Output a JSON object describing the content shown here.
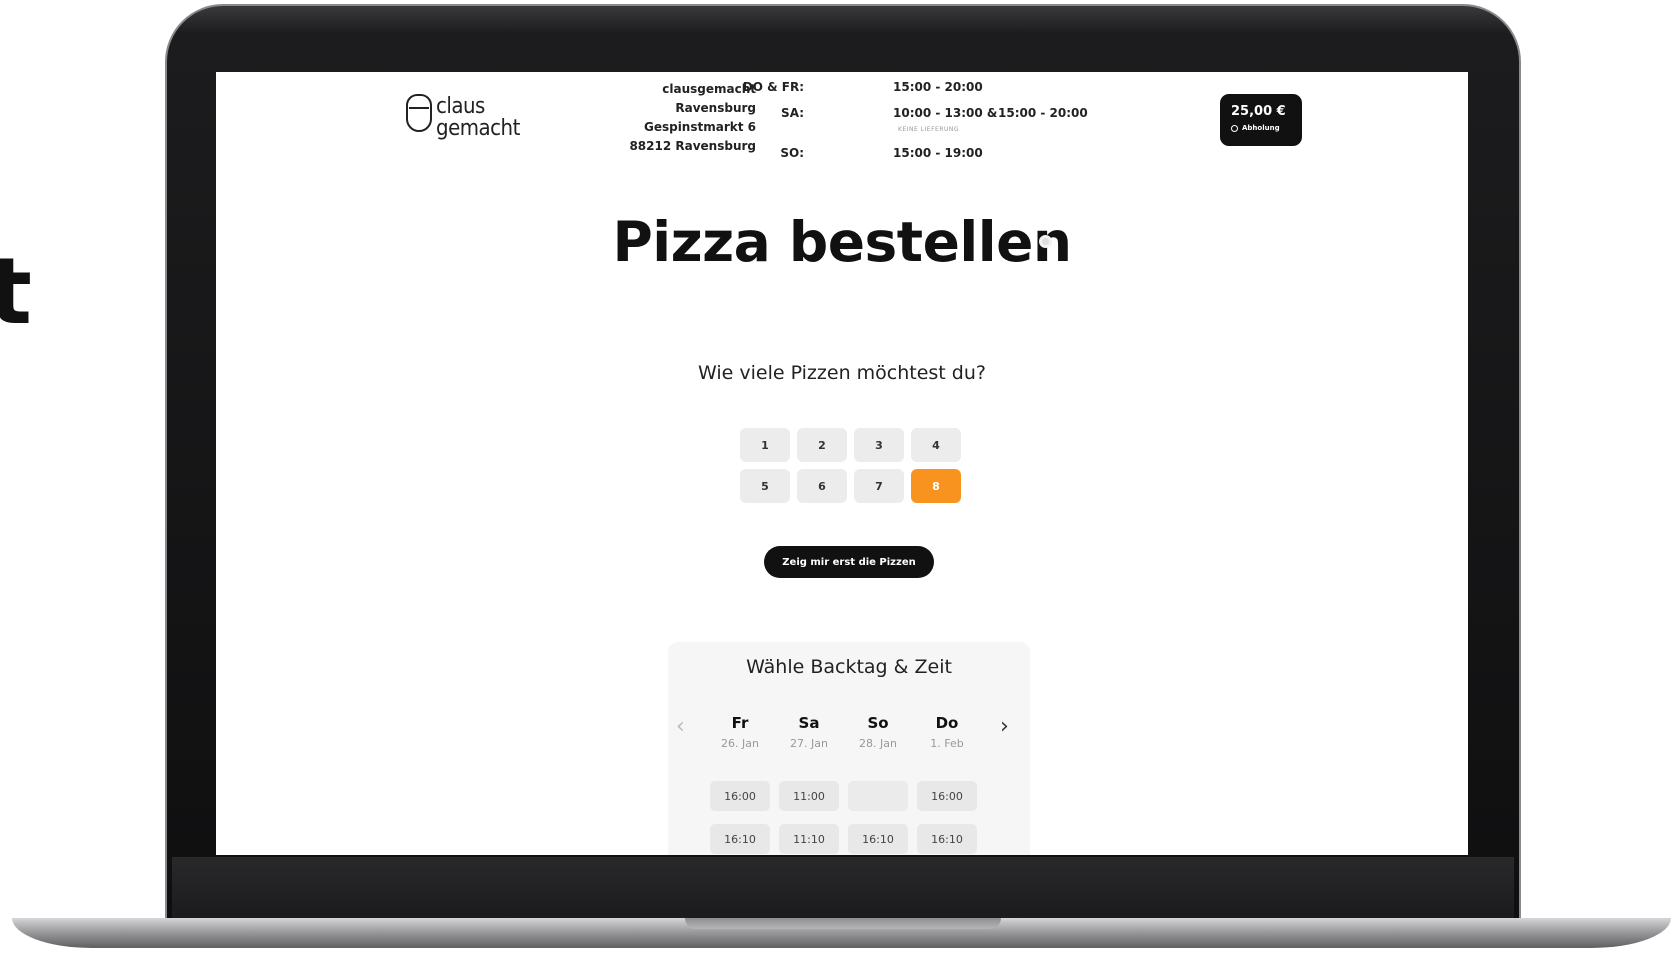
{
  "side_heading": "t",
  "brand": {
    "line1": "claus",
    "line2": "gemacht"
  },
  "address": {
    "lines": [
      "clausgemacht",
      "Ravensburg",
      "Gespinstmarkt 6",
      "88212 Ravensburg"
    ]
  },
  "hours": {
    "do_fr_label": "DO & FR:",
    "do_fr_value": "15:00 - 20:00",
    "sa_label": "SA:",
    "sa_value_1": "10:00 - 13:00 &",
    "sa_value_2": "15:00 - 20:00",
    "sa_note": "KEINE LIEFERUNG",
    "so_label": "SO:",
    "so_value": "15:00 - 19:00"
  },
  "cart": {
    "price": "25,00 €",
    "mode": "Abholung"
  },
  "page": {
    "title": "Pizza bestellen",
    "question": "Wie viele Pizzen möchtest du?",
    "quantities": [
      "1",
      "2",
      "3",
      "4",
      "5",
      "6",
      "7",
      "8"
    ],
    "selected_quantity": "8",
    "show_pizzas_label": "Zeig mir erst die Pizzen"
  },
  "scheduler": {
    "title": "Wähle Backtag & Zeit",
    "prev_icon": "chevron-left-icon",
    "next_icon": "chevron-right-icon",
    "days": [
      {
        "name": "Fr",
        "date": "26. Jan",
        "slots": [
          "16:00",
          "16:10"
        ]
      },
      {
        "name": "Sa",
        "date": "27. Jan",
        "slots": [
          "11:00",
          "11:10"
        ]
      },
      {
        "name": "So",
        "date": "28. Jan",
        "slots": [
          "",
          "16:10"
        ]
      },
      {
        "name": "Do",
        "date": "1. Feb",
        "slots": [
          "16:00",
          "16:10"
        ]
      }
    ]
  },
  "colors": {
    "accent": "#f7931e",
    "dark": "#111111",
    "panel": "#f6f6f6"
  }
}
